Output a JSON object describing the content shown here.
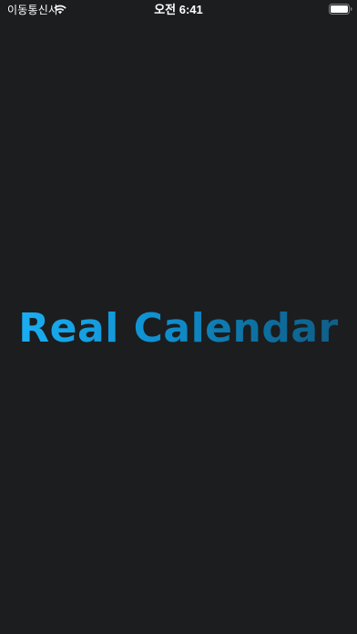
{
  "status_bar": {
    "carrier": "이동통신사",
    "time": "오전 6:41",
    "wifi_icon": "wifi-icon",
    "battery_icon": "battery-icon"
  },
  "splash": {
    "title": "Real Calendar"
  },
  "colors": {
    "background": "#1c1d1f",
    "title_gradient_start": "#1aaef2",
    "title_gradient_end": "#0f5f88"
  }
}
